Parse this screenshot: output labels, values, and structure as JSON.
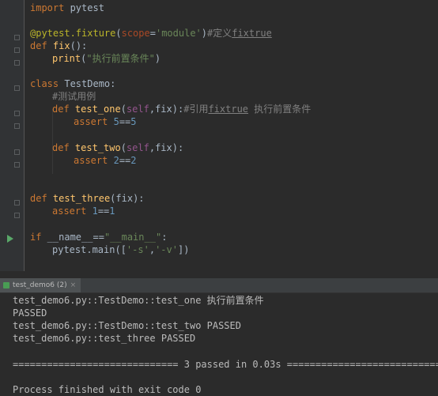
{
  "editor": {
    "lines": [
      {
        "kw": "import",
        "rest": " pytest"
      },
      {},
      {
        "dec": "@pytest.fixture",
        "p1": "(",
        "param": "scope",
        "eq": "=",
        "str": "'module'",
        "p2": ")",
        "cmt": "#定义",
        "cmt_ul": "fixtrue"
      },
      {
        "kw": "def",
        "fn": "fix",
        "rest": "():"
      },
      {
        "fn": "print",
        "p1": "(",
        "str": "\"执行前置条件\"",
        "p2": ")"
      },
      {},
      {
        "kw": "class",
        "rest": " TestDemo:"
      },
      {
        "cmt": "#测试用例"
      },
      {
        "kw": "def",
        "fn": "test_one",
        "p1": "(",
        "self": "self",
        "rest": ",fix):",
        "cmt": "#引用",
        "cmt_ul": "fixtrue",
        "cmt2": " 执行前置条件"
      },
      {
        "kw": "assert",
        "num1": "5",
        "op": "==",
        "num2": "5"
      },
      {},
      {
        "kw": "def",
        "fn": "test_two",
        "p1": "(",
        "self": "self",
        "rest": ",fix):"
      },
      {
        "kw": "assert",
        "num1": "2",
        "op": "==",
        "num2": "2"
      },
      {},
      {},
      {
        "kw": "def",
        "fn": "test_three",
        "rest": "(fix):"
      },
      {
        "kw": "assert",
        "num1": "1",
        "op": "==",
        "num2": "1"
      },
      {},
      {
        "kw": "if",
        "rest": " __name__==",
        "str": "\"__main__\"",
        "colon": ":"
      },
      {
        "pre": "pytest.main([",
        "str1": "'-s'",
        "comma": ",",
        "str2": "'-v'",
        "post": "])"
      }
    ]
  },
  "run_panel": {
    "tab_label": "test_demo6 (2)",
    "tab_close": "×",
    "output": [
      "test_demo6.py::TestDemo::test_one 执行前置条件",
      "PASSED",
      "test_demo6.py::TestDemo::test_two PASSED",
      "test_demo6.py::test_three PASSED",
      "",
      "============================= 3 passed in 0.03s ==============================",
      "",
      "Process finished with exit code 0"
    ]
  },
  "colors": {
    "background": "#2b2b2b",
    "keyword": "#cc7832",
    "function": "#ffc66d",
    "string": "#6a8759",
    "number": "#6897bb",
    "comment": "#808080",
    "decorator": "#bbb529",
    "run_icon": "#59a869"
  },
  "icons": {
    "run_gutter": "run-arrow-icon",
    "fold": "fold-marker-icon",
    "tab": "python-run-icon",
    "close": "close-icon"
  }
}
